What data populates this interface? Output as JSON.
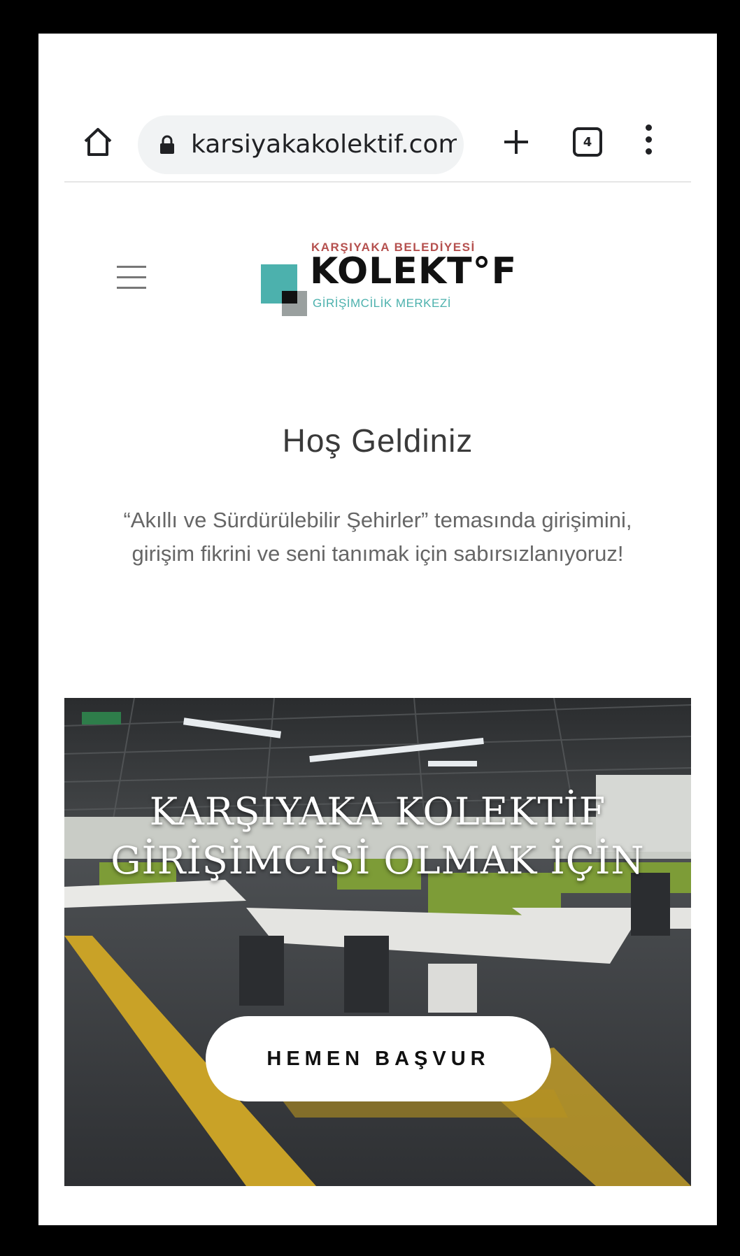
{
  "browser": {
    "url": "karsiyakakolektif.com.",
    "tab_count": "4"
  },
  "site": {
    "logo": {
      "top_text": "KARŞIYAKA BELEDİYESİ",
      "main_text": "KOLEKT°F",
      "sub_text": "GİRİŞİMCİLİK MERKEZİ",
      "colors": {
        "teal": "#4cb1ad",
        "red": "#b5504e",
        "gray": "#9aa09f",
        "black": "#111111"
      }
    },
    "welcome": {
      "title": "Hoş Geldiniz",
      "text": "“Akıllı ve Sürdürülebilir Şehirler” temasında girişimini, girişim fikrini ve seni tanımak için sabırsızlanıyoruz!"
    },
    "hero": {
      "title": "KARŞIYAKA KOLEKTİF GİRİŞİMCİSİ OLMAK İÇİN",
      "button_label": "HEMEN BAŞVUR"
    }
  }
}
